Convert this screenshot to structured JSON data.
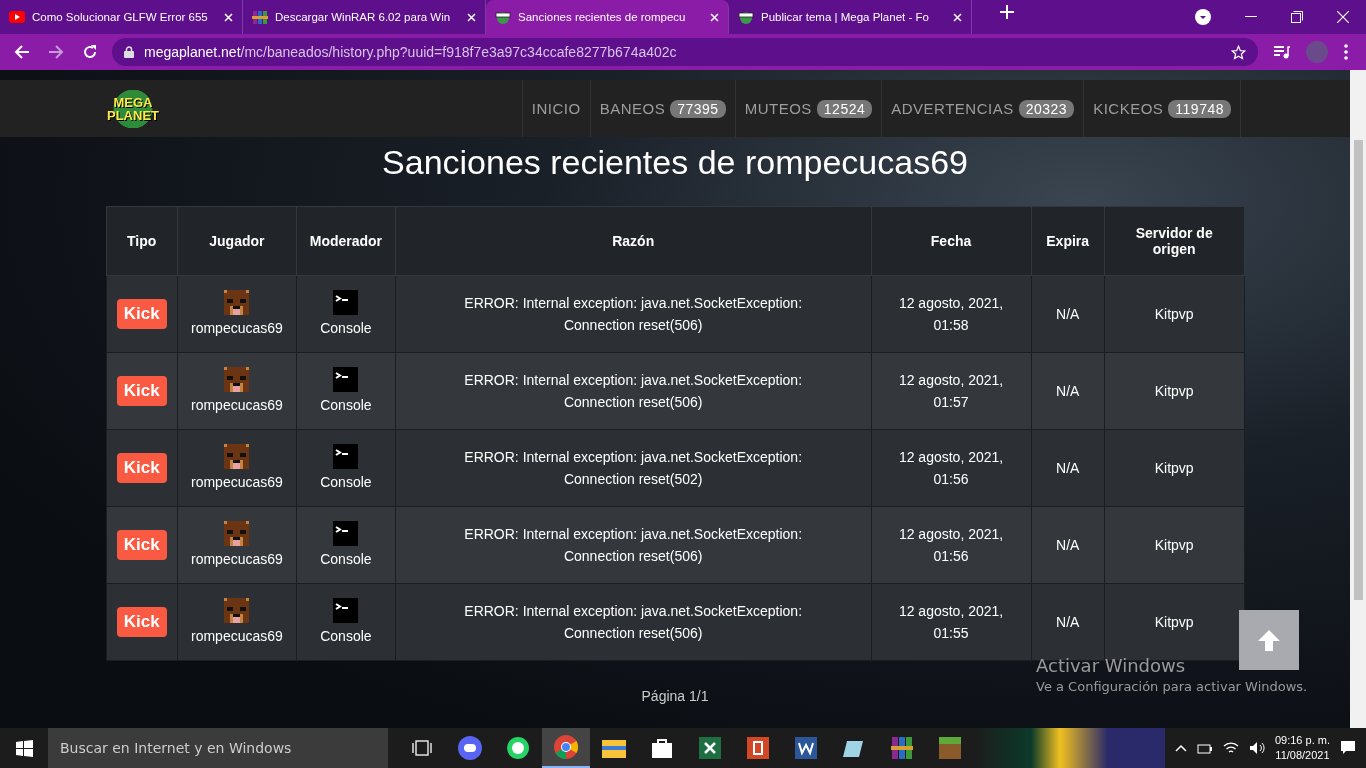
{
  "browser": {
    "tabs": [
      {
        "title": "Como Solucionar GLFW Error 655",
        "kind": "video",
        "selected": false
      },
      {
        "title": "Descargar WinRAR 6.02 para Win",
        "kind": "archive",
        "selected": false
      },
      {
        "title": "Sanciones recientes de rompecu",
        "kind": "forum",
        "selected": true
      },
      {
        "title": "Publicar tema | Mega Planet - Fo",
        "kind": "forum",
        "selected": false
      }
    ],
    "url_host": "megaplanet.net",
    "url_path": "/mc/baneados/history.php?uuid=f918f7e3a97c34ccafe8277b674a402c"
  },
  "site": {
    "logo": {
      "line1": "MEGA",
      "line2": "PLANET"
    },
    "nav": [
      {
        "label": "INICIO"
      },
      {
        "label": "BANEOS",
        "count": "77395"
      },
      {
        "label": "MUTEOS",
        "count": "12524"
      },
      {
        "label": "ADVERTENCIAS",
        "count": "20323"
      },
      {
        "label": "KICKEOS",
        "count": "119748"
      }
    ],
    "title": "Sanciones recientes de rompecucas69",
    "table": {
      "columns": [
        "Tipo",
        "Jugador",
        "Moderador",
        "Razón",
        "Fecha",
        "Expira",
        "Servidor de origen"
      ],
      "rows": [
        {
          "type": "Kick",
          "kind": "kick",
          "player": "rompecucas69",
          "moderator": "Console",
          "reason": "ERROR: Internal exception: java.net.SocketException: Connection reset(506)",
          "date": "12 agosto, 2021, 01:58",
          "expires": "N/A",
          "server": "Kitpvp"
        },
        {
          "type": "Kick",
          "kind": "kick",
          "player": "rompecucas69",
          "moderator": "Console",
          "reason": "ERROR: Internal exception: java.net.SocketException: Connection reset(506)",
          "date": "12 agosto, 2021, 01:57",
          "expires": "N/A",
          "server": "Kitpvp"
        },
        {
          "type": "Kick",
          "kind": "kick",
          "player": "rompecucas69",
          "moderator": "Console",
          "reason": "ERROR: Internal exception: java.net.SocketException: Connection reset(502)",
          "date": "12 agosto, 2021, 01:56",
          "expires": "N/A",
          "server": "Kitpvp"
        },
        {
          "type": "Kick",
          "kind": "kick",
          "player": "rompecucas69",
          "moderator": "Console",
          "reason": "ERROR: Internal exception: java.net.SocketException: Connection reset(506)",
          "date": "12 agosto, 2021, 01:56",
          "expires": "N/A",
          "server": "Kitpvp"
        },
        {
          "type": "Kick",
          "kind": "kick",
          "player": "rompecucas69",
          "moderator": "Console",
          "reason": "ERROR: Internal exception: java.net.SocketException: Connection reset(506)",
          "date": "12 agosto, 2021, 01:55",
          "expires": "N/A",
          "server": "Kitpvp"
        }
      ]
    },
    "pagination": "Página 1/1"
  },
  "activation": {
    "title": "Activar Windows",
    "message": "Ve a Configuración para activar Windows."
  },
  "taskbar": {
    "search_placeholder": "Buscar en Internet y en Windows",
    "time": "09:16 p. m.",
    "date": "11/08/2021"
  }
}
